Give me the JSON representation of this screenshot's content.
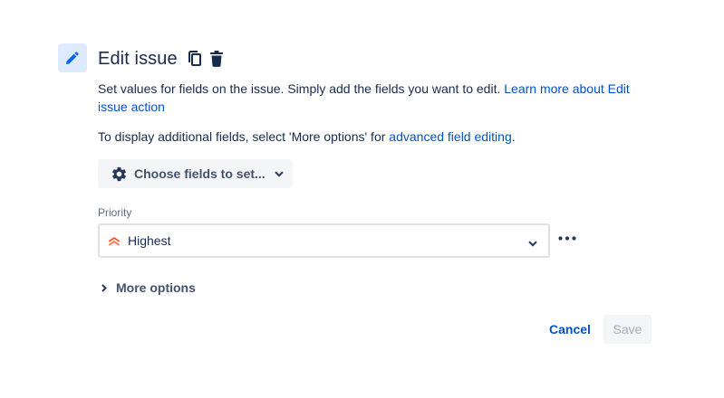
{
  "header": {
    "title": "Edit issue",
    "icons": [
      "pencil-icon",
      "copy-icon",
      "trash-icon"
    ]
  },
  "description": {
    "text": "Set values for fields on the issue. Simply add the fields you want to edit. ",
    "link": "Learn more about Edit issue action"
  },
  "additional": {
    "text_before": "To display additional fields, select 'More options' for ",
    "link": "advanced field editing",
    "text_after": "."
  },
  "choose_fields": {
    "label": "Choose fields to set...",
    "icon": "gear-icon"
  },
  "priority_field": {
    "label": "Priority",
    "value": "Highest",
    "icon": "priority-highest-icon"
  },
  "more_options": {
    "label": "More options"
  },
  "footer": {
    "cancel_label": "Cancel",
    "save_label": "Save"
  },
  "colors": {
    "accent": "#0052cc",
    "icon_box_bg": "#deebff",
    "priority_highest": "#ff5630",
    "button_bg": "#f4f5f7"
  }
}
